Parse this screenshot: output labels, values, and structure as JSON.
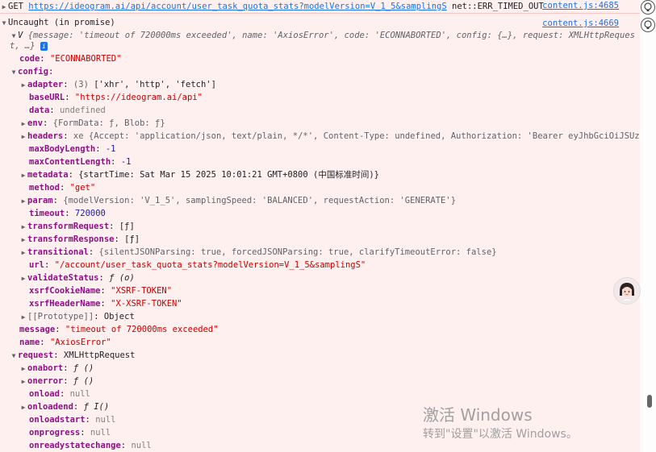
{
  "header": {
    "method": "GET",
    "url": "https://ideogram.ai/api/account/user_task_quota_stats?modelVersion=V_1_5&samplingS",
    "error": "net::ERR_TIMED_OUT",
    "source": "content.js:4685"
  },
  "uncaught": {
    "text": "Uncaught (in promise)",
    "source": "content.js:4669"
  },
  "summary": {
    "prefix": "V",
    "line1": "{message: 'timeout of 720000ms exceeded', name: 'AxiosError', code: 'ECONNABORTED', config: {…}, request: XMLHttpReques",
    "line2": "t, …}",
    "info": "i"
  },
  "props": {
    "code": {
      "key": "code",
      "value": "\"ECONNABORTED\""
    },
    "config": {
      "key": "config"
    },
    "adapter": {
      "key": "adapter",
      "count": "(3)",
      "value": "['xhr', 'http', 'fetch']"
    },
    "baseURL": {
      "key": "baseURL",
      "value": "\"https://ideogram.ai/api\""
    },
    "data": {
      "key": "data",
      "value": "undefined"
    },
    "env": {
      "key": "env",
      "value": "{FormData: ƒ, Blob: ƒ}"
    },
    "headers": {
      "key": "headers",
      "type": "xe",
      "value": "{Accept: 'application/json, text/plain, */*', Content-Type: undefined, Authorization: 'Bearer eyJhbGciOiJSUzI"
    },
    "maxBodyLength": {
      "key": "maxBodyLength",
      "value": "-1"
    },
    "maxContentLength": {
      "key": "maxContentLength",
      "value": "-1"
    },
    "metadata": {
      "key": "metadata",
      "value": "{startTime: Sat Mar 15 2025 10:01:21 GMT+0800 (中国标准时间)}"
    },
    "method": {
      "key": "method",
      "value": "\"get\""
    },
    "param": {
      "key": "param",
      "value": "{modelVersion: 'V_1_5', samplingSpeed: 'BALANCED', requestAction: 'GENERATE'}"
    },
    "timeout": {
      "key": "timeout",
      "value": "720000"
    },
    "transformRequest": {
      "key": "transformRequest",
      "value": "[ƒ]"
    },
    "transformResponse": {
      "key": "transformResponse",
      "value": "[ƒ]"
    },
    "transitional": {
      "key": "transitional",
      "value": "{silentJSONParsing: true, forcedJSONParsing: true, clarifyTimeoutError: false}"
    },
    "url": {
      "key": "url",
      "value": "\"/account/user_task_quota_stats?modelVersion=V_1_5&samplingS\""
    },
    "validateStatus": {
      "key": "validateStatus",
      "value": "ƒ (o)"
    },
    "xsrfCookieName": {
      "key": "xsrfCookieName",
      "value": "\"XSRF-TOKEN\""
    },
    "xsrfHeaderName": {
      "key": "xsrfHeaderName",
      "value": "\"X-XSRF-TOKEN\""
    },
    "prototype": {
      "key": "[[Prototype]]",
      "value": "Object"
    },
    "message": {
      "key": "message",
      "value": "\"timeout of 720000ms exceeded\""
    },
    "name": {
      "key": "name",
      "value": "\"AxiosError\""
    },
    "request": {
      "key": "request",
      "value": "XMLHttpRequest"
    },
    "onabort": {
      "key": "onabort",
      "value": "ƒ ()"
    },
    "onerror": {
      "key": "onerror",
      "value": "ƒ ()"
    },
    "onload": {
      "key": "onload",
      "value": "null"
    },
    "onloadend": {
      "key": "onloadend",
      "value": "ƒ I()"
    },
    "onloadstart": {
      "key": "onloadstart",
      "value": "null"
    },
    "onprogress": {
      "key": "onprogress",
      "value": "null"
    },
    "onreadystatechange": {
      "key": "onreadystatechange",
      "value": "null"
    }
  },
  "watermark": {
    "line1": "激活 Windows",
    "line2": "转到\"设置\"以激活 Windows。"
  }
}
